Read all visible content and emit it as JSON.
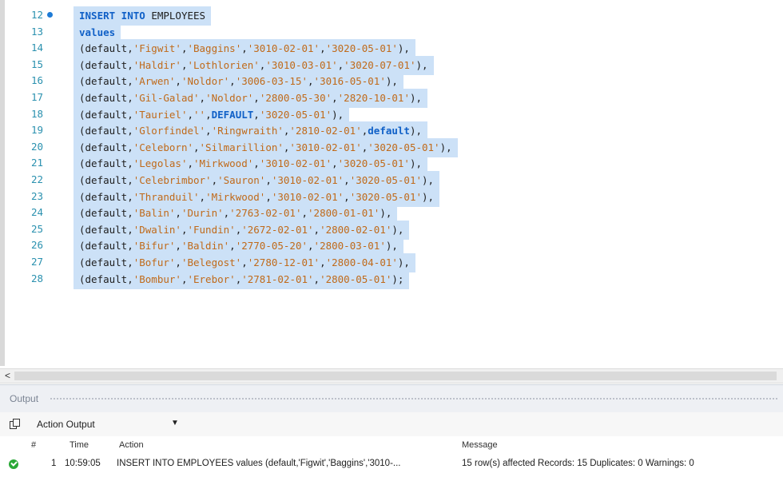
{
  "editor": {
    "lines": [
      {
        "num": "12",
        "marker": true,
        "code": [
          [
            "kw",
            "INSERT INTO"
          ],
          [
            "pn",
            " EMPLOYEES"
          ]
        ]
      },
      {
        "num": "13",
        "marker": false,
        "code": [
          [
            "kw",
            "values"
          ]
        ]
      },
      {
        "num": "14",
        "marker": false,
        "code": [
          [
            "pn",
            "(default,"
          ],
          [
            "str",
            "'Figwit'"
          ],
          [
            "pn",
            ","
          ],
          [
            "str",
            "'Baggins'"
          ],
          [
            "pn",
            ","
          ],
          [
            "str",
            "'3010-02-01'"
          ],
          [
            "pn",
            ","
          ],
          [
            "str",
            "'3020-05-01'"
          ],
          [
            "pn",
            "),"
          ]
        ]
      },
      {
        "num": "15",
        "marker": false,
        "code": [
          [
            "pn",
            "(default,"
          ],
          [
            "str",
            "'Haldir'"
          ],
          [
            "pn",
            ","
          ],
          [
            "str",
            "'Lothlorien'"
          ],
          [
            "pn",
            ","
          ],
          [
            "str",
            "'3010-03-01'"
          ],
          [
            "pn",
            ","
          ],
          [
            "str",
            "'3020-07-01'"
          ],
          [
            "pn",
            "),"
          ]
        ]
      },
      {
        "num": "16",
        "marker": false,
        "code": [
          [
            "pn",
            "(default,"
          ],
          [
            "str",
            "'Arwen'"
          ],
          [
            "pn",
            ","
          ],
          [
            "str",
            "'Noldor'"
          ],
          [
            "pn",
            ","
          ],
          [
            "str",
            "'3006-03-15'"
          ],
          [
            "pn",
            ","
          ],
          [
            "str",
            "'3016-05-01'"
          ],
          [
            "pn",
            "),"
          ]
        ]
      },
      {
        "num": "17",
        "marker": false,
        "code": [
          [
            "pn",
            "(default,"
          ],
          [
            "str",
            "'Gil-Galad'"
          ],
          [
            "pn",
            ","
          ],
          [
            "str",
            "'Noldor'"
          ],
          [
            "pn",
            ","
          ],
          [
            "str",
            "'2800-05-30'"
          ],
          [
            "pn",
            ","
          ],
          [
            "str",
            "'2820-10-01'"
          ],
          [
            "pn",
            "),"
          ]
        ]
      },
      {
        "num": "18",
        "marker": false,
        "code": [
          [
            "pn",
            "(default,"
          ],
          [
            "str",
            "'Tauriel'"
          ],
          [
            "pn",
            ","
          ],
          [
            "str",
            "''"
          ],
          [
            "pn",
            ","
          ],
          [
            "kw",
            "DEFAULT"
          ],
          [
            "pn",
            ","
          ],
          [
            "str",
            "'3020-05-01'"
          ],
          [
            "pn",
            "),"
          ]
        ]
      },
      {
        "num": "19",
        "marker": false,
        "code": [
          [
            "pn",
            "(default,"
          ],
          [
            "str",
            "'Glorfindel'"
          ],
          [
            "pn",
            ","
          ],
          [
            "str",
            "'Ringwraith'"
          ],
          [
            "pn",
            ","
          ],
          [
            "str",
            "'2810-02-01'"
          ],
          [
            "pn",
            ","
          ],
          [
            "kw",
            "default"
          ],
          [
            "pn",
            "),"
          ]
        ]
      },
      {
        "num": "20",
        "marker": false,
        "code": [
          [
            "pn",
            "(default,"
          ],
          [
            "str",
            "'Celeborn'"
          ],
          [
            "pn",
            ","
          ],
          [
            "str",
            "'Silmarillion'"
          ],
          [
            "pn",
            ","
          ],
          [
            "str",
            "'3010-02-01'"
          ],
          [
            "pn",
            ","
          ],
          [
            "str",
            "'3020-05-01'"
          ],
          [
            "pn",
            "),"
          ]
        ]
      },
      {
        "num": "21",
        "marker": false,
        "code": [
          [
            "pn",
            "(default,"
          ],
          [
            "str",
            "'Legolas'"
          ],
          [
            "pn",
            ","
          ],
          [
            "str",
            "'Mirkwood'"
          ],
          [
            "pn",
            ","
          ],
          [
            "str",
            "'3010-02-01'"
          ],
          [
            "pn",
            ","
          ],
          [
            "str",
            "'3020-05-01'"
          ],
          [
            "pn",
            "),"
          ]
        ]
      },
      {
        "num": "22",
        "marker": false,
        "code": [
          [
            "pn",
            "(default,"
          ],
          [
            "str",
            "'Celebrimbor'"
          ],
          [
            "pn",
            ","
          ],
          [
            "str",
            "'Sauron'"
          ],
          [
            "pn",
            ","
          ],
          [
            "str",
            "'3010-02-01'"
          ],
          [
            "pn",
            ","
          ],
          [
            "str",
            "'3020-05-01'"
          ],
          [
            "pn",
            "),"
          ]
        ]
      },
      {
        "num": "23",
        "marker": false,
        "code": [
          [
            "pn",
            "(default,"
          ],
          [
            "str",
            "'Thranduil'"
          ],
          [
            "pn",
            ","
          ],
          [
            "str",
            "'Mirkwood'"
          ],
          [
            "pn",
            ","
          ],
          [
            "str",
            "'3010-02-01'"
          ],
          [
            "pn",
            ","
          ],
          [
            "str",
            "'3020-05-01'"
          ],
          [
            "pn",
            "),"
          ]
        ]
      },
      {
        "num": "24",
        "marker": false,
        "code": [
          [
            "pn",
            "(default,"
          ],
          [
            "str",
            "'Balin'"
          ],
          [
            "pn",
            ","
          ],
          [
            "str",
            "'Durin'"
          ],
          [
            "pn",
            ","
          ],
          [
            "str",
            "'2763-02-01'"
          ],
          [
            "pn",
            ","
          ],
          [
            "str",
            "'2800-01-01'"
          ],
          [
            "pn",
            "),"
          ]
        ]
      },
      {
        "num": "25",
        "marker": false,
        "code": [
          [
            "pn",
            "(default,"
          ],
          [
            "str",
            "'Dwalin'"
          ],
          [
            "pn",
            ","
          ],
          [
            "str",
            "'Fundin'"
          ],
          [
            "pn",
            ","
          ],
          [
            "str",
            "'2672-02-01'"
          ],
          [
            "pn",
            ","
          ],
          [
            "str",
            "'2800-02-01'"
          ],
          [
            "pn",
            "),"
          ]
        ]
      },
      {
        "num": "26",
        "marker": false,
        "code": [
          [
            "pn",
            "(default,"
          ],
          [
            "str",
            "'Bifur'"
          ],
          [
            "pn",
            ","
          ],
          [
            "str",
            "'Baldin'"
          ],
          [
            "pn",
            ","
          ],
          [
            "str",
            "'2770-05-20'"
          ],
          [
            "pn",
            ","
          ],
          [
            "str",
            "'2800-03-01'"
          ],
          [
            "pn",
            "),"
          ]
        ]
      },
      {
        "num": "27",
        "marker": false,
        "code": [
          [
            "pn",
            "(default,"
          ],
          [
            "str",
            "'Bofur'"
          ],
          [
            "pn",
            ","
          ],
          [
            "str",
            "'Belegost'"
          ],
          [
            "pn",
            ","
          ],
          [
            "str",
            "'2780-12-01'"
          ],
          [
            "pn",
            ","
          ],
          [
            "str",
            "'2800-04-01'"
          ],
          [
            "pn",
            "),"
          ]
        ]
      },
      {
        "num": "28",
        "marker": false,
        "code": [
          [
            "pn",
            "(default,"
          ],
          [
            "str",
            "'Bombur'"
          ],
          [
            "pn",
            ","
          ],
          [
            "str",
            "'Erebor'"
          ],
          [
            "pn",
            ","
          ],
          [
            "str",
            "'2781-02-01'"
          ],
          [
            "pn",
            ","
          ],
          [
            "str",
            "'2800-05-01'"
          ],
          [
            "pn",
            ");"
          ]
        ]
      }
    ]
  },
  "scrollbar": {
    "left_arrow": "<"
  },
  "output_panel": {
    "title": "Output",
    "dropdown_value": "Action Output",
    "columns": {
      "num": "#",
      "time": "Time",
      "action": "Action",
      "message": "Message"
    },
    "rows": [
      {
        "status": "success",
        "num": "1",
        "time": "10:59:05",
        "action": "INSERT INTO EMPLOYEES  values (default,'Figwit','Baggins','3010-...",
        "message": "15 row(s) affected Records: 15  Duplicates: 0  Warnings: 0"
      }
    ]
  },
  "colors": {
    "keyword": "#1060c7",
    "string": "#c06a1a",
    "line_number": "#2b91af",
    "selection": "#cce1f7"
  }
}
